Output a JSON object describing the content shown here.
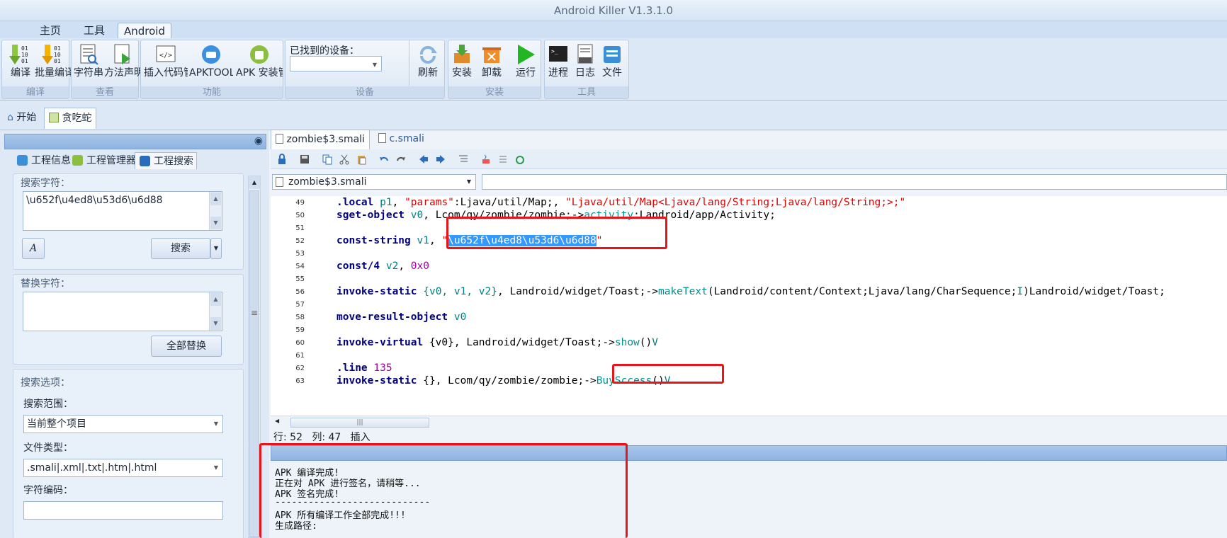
{
  "app_title": "Android Killer V1.3.1.0",
  "ribbon_tabs": [
    "主页",
    "工具",
    "Android"
  ],
  "ribbon": {
    "groups": {
      "compile": "编译",
      "view": "查看",
      "function": "功能",
      "device": "设备",
      "install": "安装",
      "tools": "工具"
    },
    "buttons": {
      "compile": "编译",
      "batch_compile": "批量编译",
      "strings": "字符串",
      "method_decl": "方法声明",
      "insert_code": "插入代码管理器",
      "apktool": "APKTOOL管理器",
      "apk_install": "APK 安装管理器",
      "refresh": "刷新",
      "install": "安装",
      "uninstall": "卸载",
      "run": "运行",
      "process": "进程",
      "log": "日志",
      "file": "文件"
    },
    "device_label": "已找到的设备：",
    "device_value": ""
  },
  "doc_tabs": [
    "开始",
    "贪吃蛇"
  ],
  "left_panel": {
    "tabs": [
      "工程信息",
      "工程管理器",
      "工程搜索"
    ],
    "search_label": "搜索字符：",
    "search_value": "\\u652f\\u4ed8\\u53d6\\u6d88",
    "search_button": "搜索",
    "replace_label": "替换字符：",
    "replace_value": "",
    "replace_all_button": "全部替换",
    "options_label": "搜索选项：",
    "scope_label": "搜索范围：",
    "scope_value": "当前整个项目",
    "filetype_label": "文件类型：",
    "filetype_value": ".smali|.xml|.txt|.htm|.html",
    "encoding_label": "字符编码："
  },
  "editor": {
    "tabs": [
      "zombie$3.smali",
      "c.smali"
    ],
    "file_combo": "zombie$3.smali",
    "line_numbers": [
      "49",
      "50",
      "51",
      "52",
      "53",
      "54",
      "55",
      "56",
      "57",
      "58",
      "59",
      "60",
      "61",
      "62",
      "63"
    ],
    "lines": {
      "l49_a": ".local",
      "l49_b": " p1",
      "l49_c": ", ",
      "l49_d": "\"params\"",
      "l49_e": ":Ljava/util/Map;, ",
      "l49_f": "\"Ljava/util/Map<Ljava/lang/String;Ljava/lang/String;>;\"",
      "l50_a": "sget-object",
      "l50_b": " v0",
      "l50_c": ", Lcom/qy/zombie/zombie;->",
      "l50_d": "activity",
      "l50_e": ":Landroid/app/Activity;",
      "l52_a": "const-string",
      "l52_b": " v1",
      "l52_c": ", ",
      "l52_d": "\"",
      "l52_e": "\\u652f\\u4ed8\\u53d6\\u6d88",
      "l52_f": "\"",
      "l54_a": "const/4",
      "l54_b": " v2",
      "l54_c": ", ",
      "l54_d": "0x0",
      "l56_a": "invoke-static",
      "l56_b": " {v0, v1, v2}",
      "l56_c": ", Landroid/widget/Toast;->",
      "l56_d": "makeText",
      "l56_e": "(Landroid/content/Context;Ljava/lang/CharSequence;",
      "l56_f": "I",
      "l56_g": ")Landroid/widget/Toast;",
      "l58_a": "move-result-object",
      "l58_b": " v0",
      "l60_a": "invoke-virtual",
      "l60_b": " {v0}",
      "l60_c": ", Landroid/widget/Toast;->",
      "l60_d": "show",
      "l60_e": "()",
      "l60_f": "V",
      "l62_a": ".line",
      "l62_b": " 135",
      "l63_a": "invoke-static",
      "l63_b": " {}",
      "l63_c": ", Lcom/qy/zombie/zombie;->",
      "l63_d": "BuySccess",
      "l63_e": "()",
      "l63_f": "V"
    },
    "status": "行: 52   列: 47   插入"
  },
  "output": {
    "lines": [
      "APK 编译完成!",
      "正在对 APK 进行签名，请稍等...",
      "APK 签名完成!",
      "----------------------------",
      "APK 所有编译工作全部完成!!!",
      "生成路径:"
    ]
  }
}
